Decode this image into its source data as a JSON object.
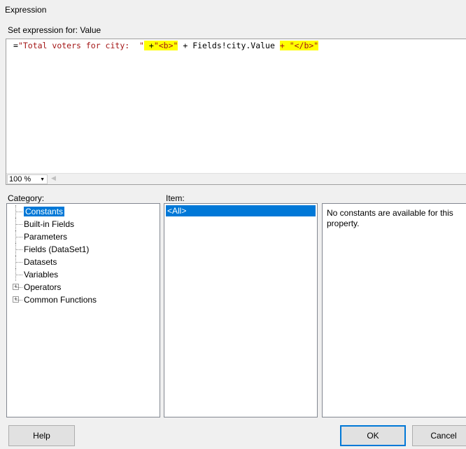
{
  "window": {
    "title": "Expression"
  },
  "expression": {
    "label": "Set expression for: Value",
    "parts": [
      "=",
      "\"Total voters for city:  \"",
      " +",
      "\"<b>\"",
      " + Fields!city.Value ",
      "+ \"</b>\""
    ],
    "zoom": "100 %"
  },
  "category": {
    "label": "Category:",
    "items": [
      {
        "label": "Constants",
        "expandable": false,
        "selected": true
      },
      {
        "label": "Built-in Fields",
        "expandable": false
      },
      {
        "label": "Parameters",
        "expandable": false
      },
      {
        "label": "Fields (DataSet1)",
        "expandable": false
      },
      {
        "label": "Datasets",
        "expandable": false
      },
      {
        "label": "Variables",
        "expandable": false
      },
      {
        "label": "Operators",
        "expandable": true
      },
      {
        "label": "Common Functions",
        "expandable": true
      }
    ]
  },
  "item": {
    "label": "Item:",
    "items": [
      "<All>"
    ]
  },
  "description": {
    "text": "No constants are available for this property."
  },
  "buttons": {
    "help": "Help",
    "ok": "OK",
    "cancel": "Cancel"
  },
  "colors": {
    "selection": "#0078d7",
    "highlight": "#ffff00",
    "string": "#a31515"
  }
}
